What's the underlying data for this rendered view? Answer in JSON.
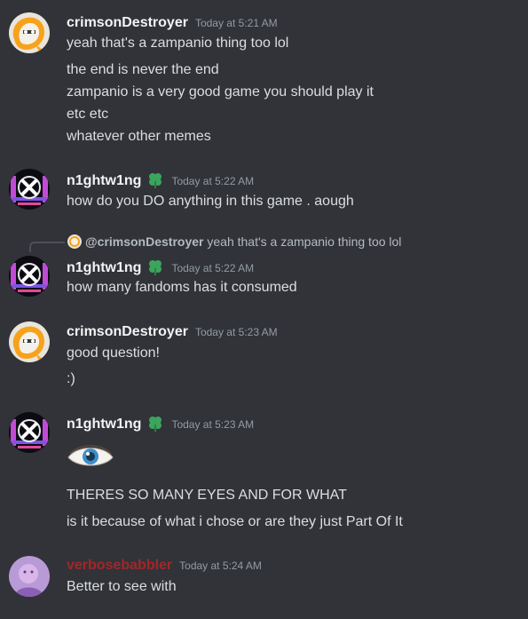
{
  "colors": {
    "background": "#313338",
    "text": "#dbdee1",
    "timestamp": "#949ba4",
    "username_default": "#f2f3f5",
    "username_red": "#a3262a",
    "badge_green": "#3ba55d"
  },
  "messages": [
    {
      "username": "crimsonDestroyer",
      "timestamp": "Today at 5:21 AM",
      "avatar_icon": "cream-duck-avatar-icon",
      "lines": [
        "yeah that's a zampanio thing too lol",
        "the end is never the end",
        "zampanio is a very good game you should play it",
        "etc etc",
        "whatever other memes"
      ]
    },
    {
      "username": "n1ghtw1ng",
      "timestamp": "Today at 5:22 AM",
      "avatar_icon": "pixel-x-avatar-icon",
      "badge_icon": "green-clover-icon",
      "lines": [
        "how do you DO anything in this game . aough"
      ]
    },
    {
      "reply": {
        "username": "@crimsonDestroyer",
        "text": "yeah that's a zampanio thing too lol"
      },
      "username": "n1ghtw1ng",
      "timestamp": "Today at 5:22 AM",
      "avatar_icon": "pixel-x-avatar-icon",
      "badge_icon": "green-clover-icon",
      "lines": [
        "how many fandoms has it consumed"
      ]
    },
    {
      "username": "crimsonDestroyer",
      "timestamp": "Today at 5:23 AM",
      "avatar_icon": "cream-duck-avatar-icon",
      "lines": [
        "good question!",
        ":)"
      ]
    },
    {
      "username": "n1ghtw1ng",
      "timestamp": "Today at 5:23 AM",
      "avatar_icon": "pixel-x-avatar-icon",
      "badge_icon": "green-clover-icon",
      "emoji_icon": "blue-eye-emoji-icon",
      "lines": [
        "THERES SO MANY EYES AND FOR WHAT",
        "is it because of what i chose or are they just Part Of It"
      ]
    },
    {
      "username": "verbosebabbler",
      "timestamp": "Today at 5:24 AM",
      "avatar_icon": "purple-figure-avatar-icon",
      "lines": [
        "Better to see with"
      ]
    }
  ]
}
